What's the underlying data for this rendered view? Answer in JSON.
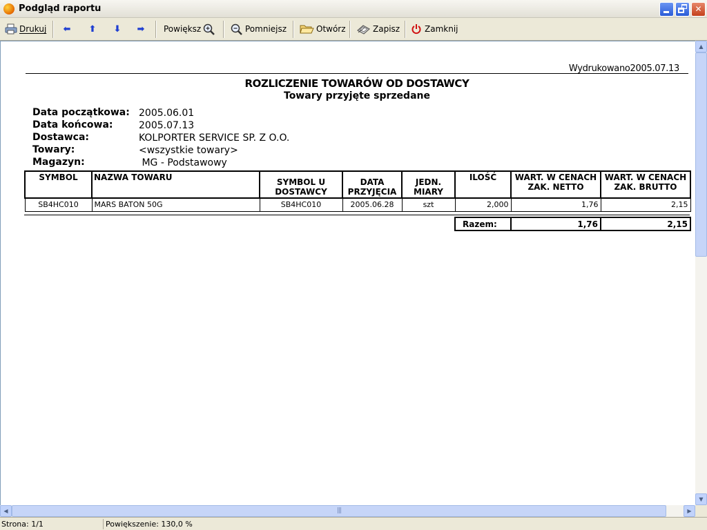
{
  "window": {
    "title": "Podgląd raportu"
  },
  "toolbar": {
    "print": "Drukuj",
    "zoom_in": "Powiększ",
    "zoom_out": "Pomniejsz",
    "open": "Otwórz",
    "save": "Zapisz",
    "close": "Zamknij"
  },
  "report": {
    "printed": "Wydrukowano2005.07.13",
    "title": "ROZLICZENIE TOWARÓW OD DOSTAWCY",
    "subtitle": "Towary przyjęte sprzedane",
    "params": [
      {
        "label": "Data początkowa:",
        "value": "2005.06.01"
      },
      {
        "label": "Data końcowa:",
        "value": "2005.07.13"
      },
      {
        "label": "Dostawca:",
        "value": "KOLPORTER SERVICE SP. Z O.O."
      },
      {
        "label": "Towary:",
        "value": "<wszystkie towary>"
      },
      {
        "label": "Magazyn:",
        "value": " MG - Podstawowy"
      }
    ],
    "columns": [
      "SYMBOL",
      "NAZWA TOWARU",
      "SYMBOL U DOSTAWCY",
      "DATA PRZYJĘCIA",
      "JEDN. MIARY",
      "ILOŚĆ",
      "WART. W CENACH ZAK. NETTO",
      "WART. W CENACH ZAK. BRUTTO"
    ],
    "rows": [
      [
        "SB4HC010",
        "MARS BATON 50G",
        "SB4HC010",
        "2005.06.28",
        "szt",
        "2,000",
        "1,76",
        "2,15"
      ]
    ],
    "totals": {
      "label": "Razem:",
      "netto": "1,76",
      "brutto": "2,15"
    }
  },
  "status": {
    "page": "Strona: 1/1",
    "zoom": "Powiększenie: 130,0 %"
  }
}
